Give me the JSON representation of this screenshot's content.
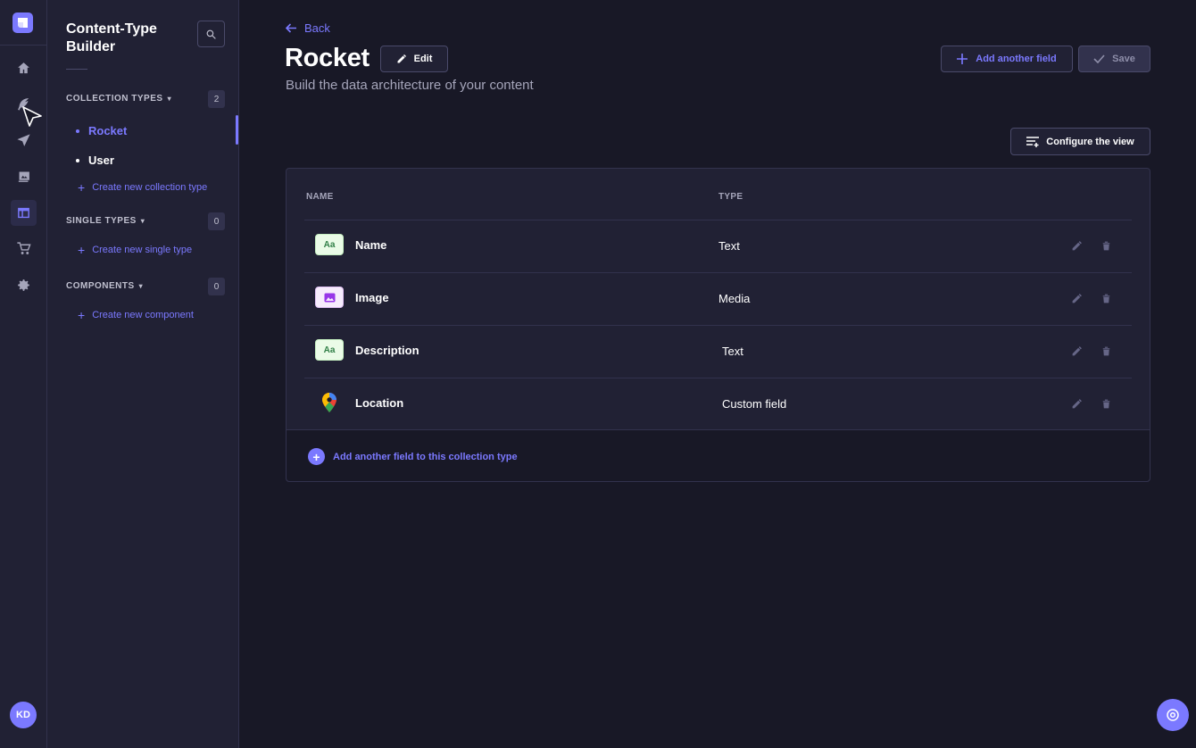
{
  "rail": {
    "items": [
      {
        "icon": "home-icon"
      },
      {
        "icon": "feather-icon"
      },
      {
        "icon": "send-icon"
      },
      {
        "icon": "media-library-icon"
      },
      {
        "icon": "layout-icon",
        "active": true
      },
      {
        "icon": "cart-icon"
      },
      {
        "icon": "settings-gear-icon"
      }
    ],
    "avatar_initials": "KD"
  },
  "subnav": {
    "title": "Content-Type Builder",
    "collection_types": {
      "label": "COLLECTION TYPES",
      "count": "2",
      "items": [
        "Rocket",
        "User"
      ],
      "active": "Rocket",
      "create_label": "Create new collection type"
    },
    "single_types": {
      "label": "SINGLE TYPES",
      "count": "0",
      "create_label": "Create new single type"
    },
    "components": {
      "label": "COMPONENTS",
      "count": "0",
      "create_label": "Create new component"
    }
  },
  "header": {
    "back_label": "Back",
    "title": "Rocket",
    "edit_label": "Edit",
    "subtitle": "Build the data architecture of your content",
    "add_field_label": "Add another field",
    "save_label": "Save",
    "configure_label": "Configure the view"
  },
  "table": {
    "columns": [
      "NAME",
      "TYPE"
    ],
    "rows": [
      {
        "name": "Name",
        "type": "Text",
        "icon": "text-field-icon",
        "icon_text": "Aa"
      },
      {
        "name": "Image",
        "type": "Media",
        "icon": "media-field-icon"
      },
      {
        "name": "Description",
        "type": "Text",
        "icon": "text-field-icon",
        "icon_text": "Aa"
      },
      {
        "name": "Location",
        "type": "Custom field",
        "icon": "google-maps-pin-icon"
      }
    ],
    "footer_label": "Add another field to this collection type"
  },
  "colors": {
    "accent": "#7b79ff",
    "background": "#181826",
    "panel": "#212134",
    "border": "#32324d"
  }
}
